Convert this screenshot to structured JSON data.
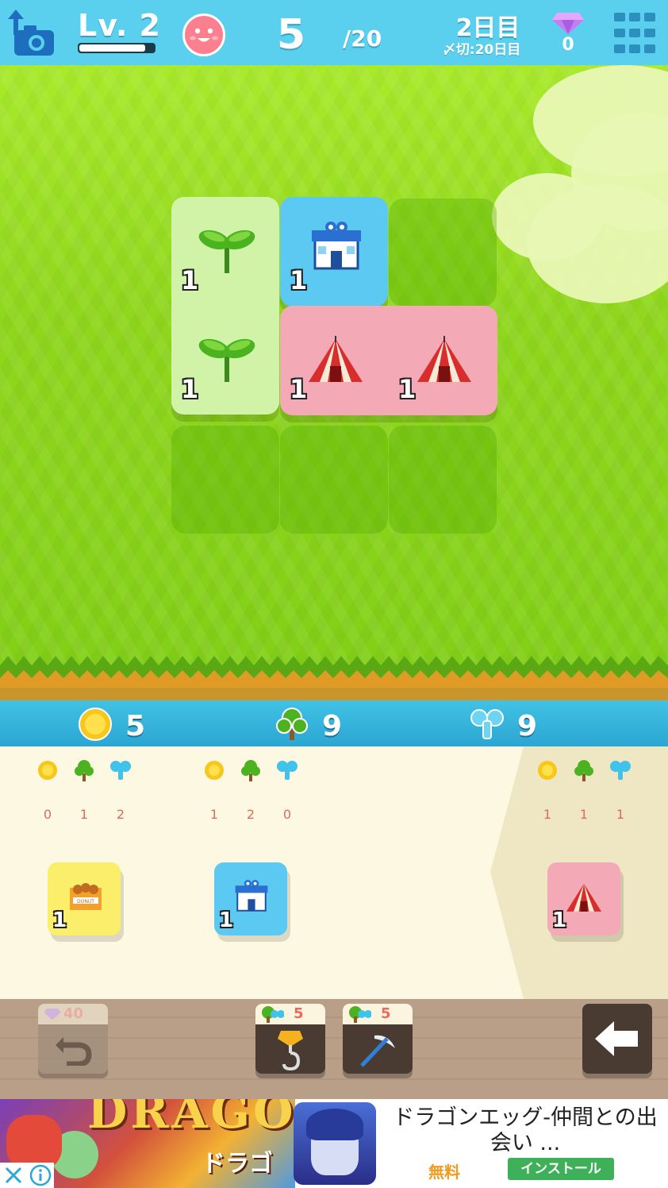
{
  "topbar": {
    "level_label": "Lv. 2",
    "level_progress": 0.88,
    "turn_current": "5",
    "turn_max": "/20",
    "day": "2日目",
    "deadline": "〆切:20日目",
    "gems": "0"
  },
  "board": {
    "tiles": [
      {
        "kind": "sprout",
        "color": "green",
        "level": "1"
      },
      {
        "kind": "house",
        "color": "blue",
        "level": "1"
      },
      {
        "kind": "sprout",
        "color": "green",
        "level": "1"
      },
      {
        "kind": "tent",
        "color": "pink",
        "level": "1"
      },
      {
        "kind": "tent",
        "color": "pink",
        "level": "1"
      }
    ]
  },
  "resources": {
    "coins": "5",
    "trees": "9",
    "water": "9"
  },
  "shop": {
    "items": [
      {
        "name": "donut-shop",
        "costs": [
          "0",
          "1",
          "2"
        ],
        "level": "1",
        "color": "#fbee6b",
        "sign": "DONUT"
      },
      {
        "name": "house",
        "costs": [
          "1",
          "2",
          "0"
        ],
        "level": "1",
        "color": "#5bc9f2"
      },
      {
        "name": "tent",
        "costs": [
          "1",
          "1",
          "1"
        ],
        "level": "1",
        "color": "#f3aab6"
      }
    ]
  },
  "toolbar": {
    "undo_cost": "40",
    "crane_cost": "5",
    "pickaxe_cost": "5"
  },
  "ad": {
    "banner_text": "DRAGO",
    "banner_sub": "ドラゴン",
    "title": "ドラゴンエッグ-仲間との出会い ...",
    "price": "無料",
    "install": "インストール"
  },
  "colors": {
    "topbar": "#5ad0ee",
    "grass": "#8fd71d",
    "resource_bar": "#2ba6d3",
    "shop_bg": "#fdf8e2",
    "toolbar": "#b99e88"
  }
}
